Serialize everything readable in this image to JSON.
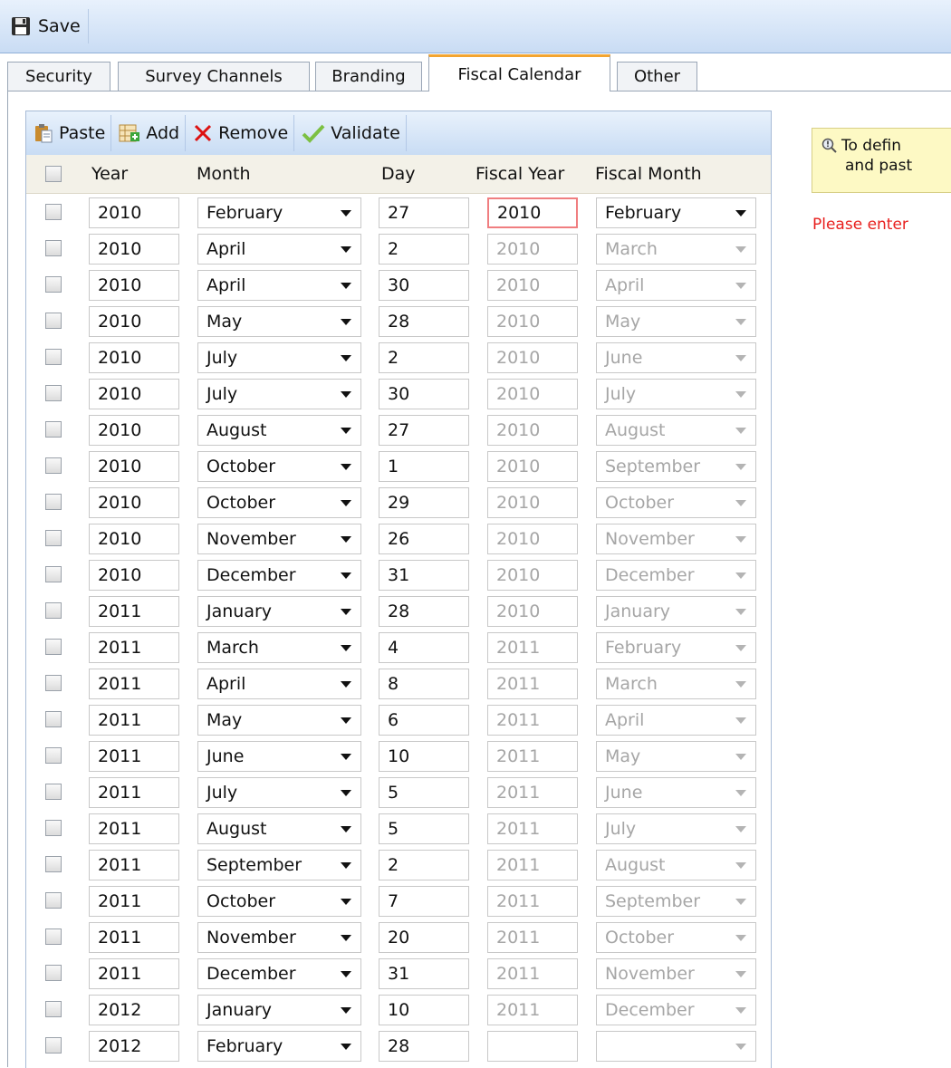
{
  "topbar": {
    "save_label": "Save"
  },
  "tabs": [
    {
      "label": "Security"
    },
    {
      "label": "Survey Channels"
    },
    {
      "label": "Branding"
    },
    {
      "label": "Fiscal Calendar",
      "active": true
    },
    {
      "label": "Other"
    }
  ],
  "toolbar": {
    "paste": "Paste",
    "add": "Add",
    "remove": "Remove",
    "validate": "Validate"
  },
  "columns": {
    "year": "Year",
    "month": "Month",
    "day": "Day",
    "fiscal_year": "Fiscal Year",
    "fiscal_month": "Fiscal Month"
  },
  "hint": {
    "line1": "To defin",
    "line2": "and past"
  },
  "error_text": "Please enter",
  "colors": {
    "error_border": "#f07e80",
    "error_text": "#e8201e",
    "active_tab": "#f3a531"
  },
  "rows": [
    {
      "year": "2010",
      "month": "February",
      "day": "27",
      "fiscal_year": "2010",
      "fiscal_month": "February",
      "editable": true
    },
    {
      "year": "2010",
      "month": "April",
      "day": "2",
      "fiscal_year": "2010",
      "fiscal_month": "March"
    },
    {
      "year": "2010",
      "month": "April",
      "day": "30",
      "fiscal_year": "2010",
      "fiscal_month": "April"
    },
    {
      "year": "2010",
      "month": "May",
      "day": "28",
      "fiscal_year": "2010",
      "fiscal_month": "May"
    },
    {
      "year": "2010",
      "month": "July",
      "day": "2",
      "fiscal_year": "2010",
      "fiscal_month": "June"
    },
    {
      "year": "2010",
      "month": "July",
      "day": "30",
      "fiscal_year": "2010",
      "fiscal_month": "July"
    },
    {
      "year": "2010",
      "month": "August",
      "day": "27",
      "fiscal_year": "2010",
      "fiscal_month": "August"
    },
    {
      "year": "2010",
      "month": "October",
      "day": "1",
      "fiscal_year": "2010",
      "fiscal_month": "September"
    },
    {
      "year": "2010",
      "month": "October",
      "day": "29",
      "fiscal_year": "2010",
      "fiscal_month": "October"
    },
    {
      "year": "2010",
      "month": "November",
      "day": "26",
      "fiscal_year": "2010",
      "fiscal_month": "November"
    },
    {
      "year": "2010",
      "month": "December",
      "day": "31",
      "fiscal_year": "2010",
      "fiscal_month": "December"
    },
    {
      "year": "2011",
      "month": "January",
      "day": "28",
      "fiscal_year": "2010",
      "fiscal_month": "January"
    },
    {
      "year": "2011",
      "month": "March",
      "day": "4",
      "fiscal_year": "2011",
      "fiscal_month": "February"
    },
    {
      "year": "2011",
      "month": "April",
      "day": "8",
      "fiscal_year": "2011",
      "fiscal_month": "March"
    },
    {
      "year": "2011",
      "month": "May",
      "day": "6",
      "fiscal_year": "2011",
      "fiscal_month": "April"
    },
    {
      "year": "2011",
      "month": "June",
      "day": "10",
      "fiscal_year": "2011",
      "fiscal_month": "May"
    },
    {
      "year": "2011",
      "month": "July",
      "day": "5",
      "fiscal_year": "2011",
      "fiscal_month": "June"
    },
    {
      "year": "2011",
      "month": "August",
      "day": "5",
      "fiscal_year": "2011",
      "fiscal_month": "July"
    },
    {
      "year": "2011",
      "month": "September",
      "day": "2",
      "fiscal_year": "2011",
      "fiscal_month": "August"
    },
    {
      "year": "2011",
      "month": "October",
      "day": "7",
      "fiscal_year": "2011",
      "fiscal_month": "September"
    },
    {
      "year": "2011",
      "month": "November",
      "day": "20",
      "fiscal_year": "2011",
      "fiscal_month": "October"
    },
    {
      "year": "2011",
      "month": "December",
      "day": "31",
      "fiscal_year": "2011",
      "fiscal_month": "November"
    },
    {
      "year": "2012",
      "month": "January",
      "day": "10",
      "fiscal_year": "2011",
      "fiscal_month": "December"
    },
    {
      "year": "2012",
      "month": "February",
      "day": "28",
      "fiscal_year": "",
      "fiscal_month": ""
    }
  ]
}
